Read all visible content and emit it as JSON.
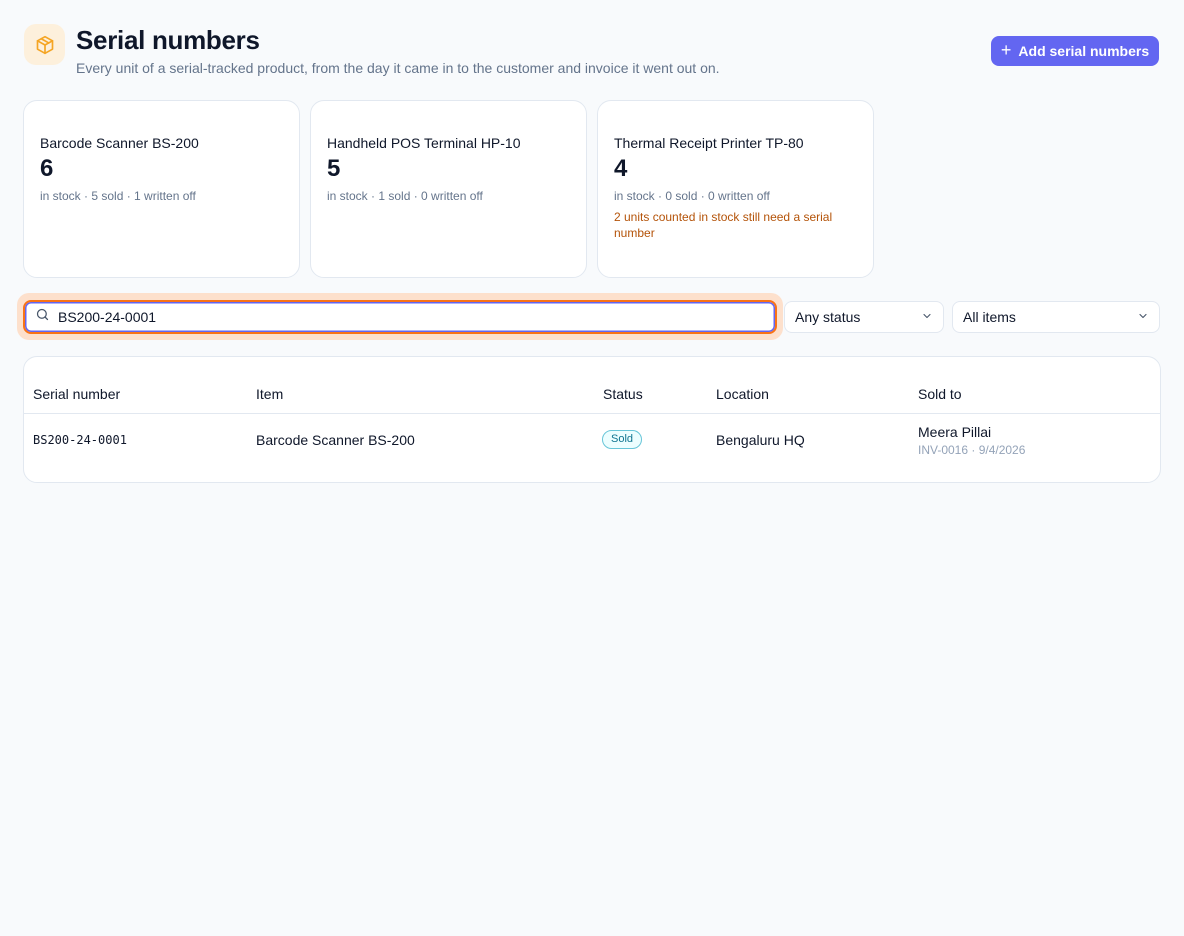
{
  "header": {
    "title": "Serial numbers",
    "subtitle": "Every unit of a serial-tracked product, from the day it came in to the customer and invoice it went out on.",
    "icon": "package-icon",
    "add_button_label": "Add serial numbers"
  },
  "colors": {
    "accent": "#6366f1",
    "focus_ring": "#f97316",
    "warning": "#b45309",
    "badge_sold": "#0e7490"
  },
  "cards": [
    {
      "name": "Barcode Scanner BS-200",
      "count": "6",
      "stats": "in stock · 5 sold · 1 written off",
      "warning": ""
    },
    {
      "name": "Handheld POS Terminal HP-10",
      "count": "5",
      "stats": "in stock · 1 sold · 0 written off",
      "warning": ""
    },
    {
      "name": "Thermal Receipt Printer TP-80",
      "count": "4",
      "stats": "in stock · 0 sold · 0 written off",
      "warning": "2 units counted in stock still need a serial number"
    }
  ],
  "filters": {
    "search_value": "BS200-24-0001",
    "status_selected": "Any status",
    "items_selected": "All items"
  },
  "table": {
    "columns": [
      "Serial number",
      "Item",
      "Status",
      "Location",
      "Sold to"
    ],
    "rows": [
      {
        "serial": "BS200-24-0001",
        "item": "Barcode Scanner BS-200",
        "status": "Sold",
        "location": "Bengaluru HQ",
        "sold_to": "Meera Pillai",
        "invoice": "INV-0016 · 9/4/2026"
      }
    ]
  }
}
